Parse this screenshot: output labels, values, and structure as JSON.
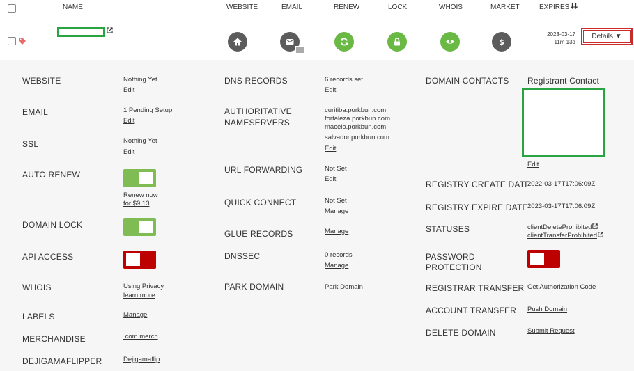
{
  "header": {
    "name": "NAME",
    "website": "WEBSITE",
    "email": "EMAIL",
    "renew": "RENEW",
    "lock": "LOCK",
    "whois": "WHOIS",
    "market": "MARKET",
    "expires": "EXPIRES",
    "sort_icon": "sort-down-arrows"
  },
  "row": {
    "expires_date": "2023-03-17",
    "expires_remaining": "11m 13d",
    "details_label": "Details ▼",
    "tag_color": "#e86b6b"
  },
  "colors": {
    "green": "#6ab945",
    "gray": "#5c5c5c",
    "toggle_on": "#7fbd54",
    "toggle_off": "#bd0000",
    "highlight": "#2aa343",
    "details_border": "#cc2b2b"
  },
  "details": {
    "col1": {
      "website": {
        "label": "WEBSITE",
        "value": "Nothing Yet",
        "link": "Edit"
      },
      "email": {
        "label": "EMAIL",
        "value": "1 Pending Setup",
        "link": "Edit"
      },
      "ssl": {
        "label": "SSL",
        "value": "Nothing Yet",
        "link": "Edit"
      },
      "auto_renew": {
        "label": "AUTO RENEW",
        "state": "on",
        "link1": "Renew now",
        "link2": "for $9.13"
      },
      "domain_lock": {
        "label": "DOMAIN LOCK",
        "state": "on"
      },
      "api_access": {
        "label": "API ACCESS",
        "state": "off"
      },
      "whois": {
        "label": "WHOIS",
        "value": "Using Privacy",
        "link": "learn more"
      },
      "labels": {
        "label": "LABELS",
        "link": "Manage"
      },
      "merch": {
        "label": "MERCHANDISE",
        "link": ".com merch"
      },
      "flipper": {
        "label": "DEJIGAMAFLIPPER",
        "link": "Dejigamaflip"
      }
    },
    "col2": {
      "dns": {
        "label": "DNS RECORDS",
        "value": "6 records set",
        "link": "Edit"
      },
      "ns": {
        "label1": "AUTHORITATIVE",
        "label2": "NAMESERVERS",
        "servers": [
          "curitiba.porkbun.com",
          "fortaleza.porkbun.com",
          "maceio.porkbun.com",
          "salvador.porkbun.com"
        ],
        "link": "Edit"
      },
      "url_fwd": {
        "label": "URL FORWARDING",
        "value": "Not Set",
        "link": "Edit"
      },
      "quick": {
        "label": "QUICK CONNECT",
        "value": "Not Set",
        "link": "Manage"
      },
      "glue": {
        "label": "GLUE RECORDS",
        "link": "Manage"
      },
      "dnssec": {
        "label": "DNSSEC",
        "value": "0 records",
        "link": "Manage"
      },
      "park": {
        "label": "PARK DOMAIN",
        "link": "Park Domain"
      }
    },
    "col3": {
      "contacts": {
        "label": "DOMAIN CONTACTS",
        "title": "Registrant Contact",
        "link": "Edit"
      },
      "create": {
        "label": "REGISTRY CREATE DATE",
        "value": "2022-03-17T17:06:09Z"
      },
      "expire": {
        "label": "REGISTRY EXPIRE DATE",
        "value": "2023-03-17T17:06:09Z"
      },
      "statuses": {
        "label": "STATUSES",
        "items": [
          "clientDeleteProhibited",
          "clientTransferProhibited"
        ]
      },
      "password": {
        "label1": "PASSWORD",
        "label2": "PROTECTION",
        "state": "off"
      },
      "reg_transfer": {
        "label": "REGISTRAR TRANSFER",
        "link": "Get Authorization Code"
      },
      "acct_transfer": {
        "label": "ACCOUNT TRANSFER",
        "link": "Push Domain"
      },
      "delete": {
        "label": "DELETE DOMAIN",
        "link": "Submit Request"
      }
    }
  }
}
